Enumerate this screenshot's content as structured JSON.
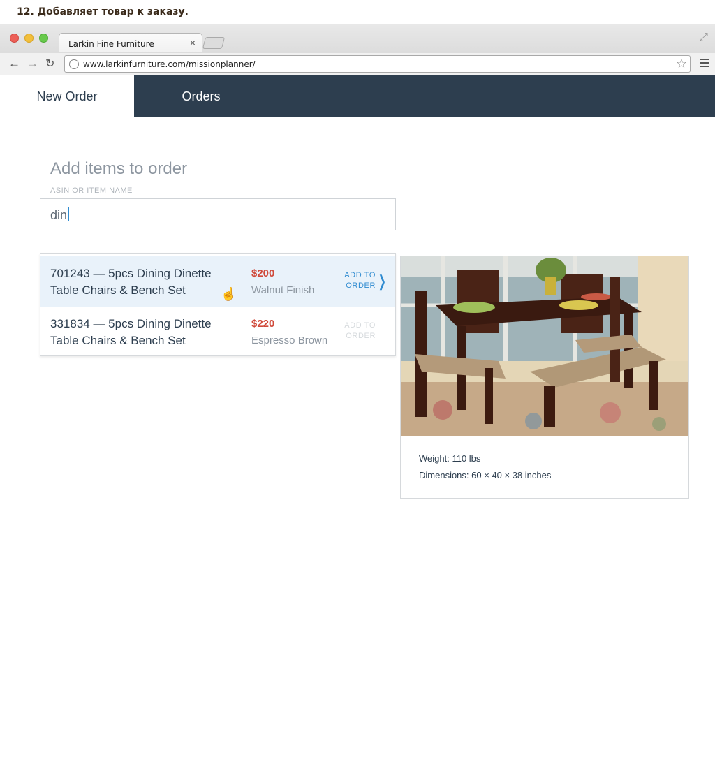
{
  "caption": "12. Добавляет товар к заказу.",
  "browser": {
    "tab_title": "Larkin Fine Furniture",
    "tab_close": "×",
    "url": "www.larkinfurniture.com/missionplanner/"
  },
  "nav": {
    "tabs": [
      {
        "label": "New Order",
        "active": true
      },
      {
        "label": "Orders",
        "active": false
      }
    ]
  },
  "main": {
    "heading": "Add items to order",
    "search": {
      "label": "ASIN OR ITEM NAME",
      "value": "din"
    },
    "results": [
      {
        "name": "701243 — 5pcs Dining Dinette Table Chairs & Bench Set",
        "price": "$200",
        "finish": "Walnut Finish",
        "action": "ADD TO ORDER",
        "highlighted": true
      },
      {
        "name": "331834 — 5pcs Dining Dinette Table Chairs & Bench Set",
        "price": "$220",
        "finish": "Espresso Brown",
        "action": "ADD TO ORDER",
        "highlighted": false
      }
    ],
    "detail": {
      "weight": "Weight: 110 lbs",
      "dimensions": "Dimensions: 60 × 40 × 38 inches"
    }
  },
  "colors": {
    "nav_bg": "#2d3e4f",
    "accent": "#2f8bd0",
    "price": "#d0493a",
    "highlight_row": "#e9f2fa"
  },
  "icons": [
    "back-arrow-icon",
    "forward-arrow-icon",
    "reload-icon",
    "globe-icon",
    "star-icon",
    "menu-icon",
    "chevron-right-icon",
    "hand-cursor-icon",
    "fullscreen-icon"
  ]
}
